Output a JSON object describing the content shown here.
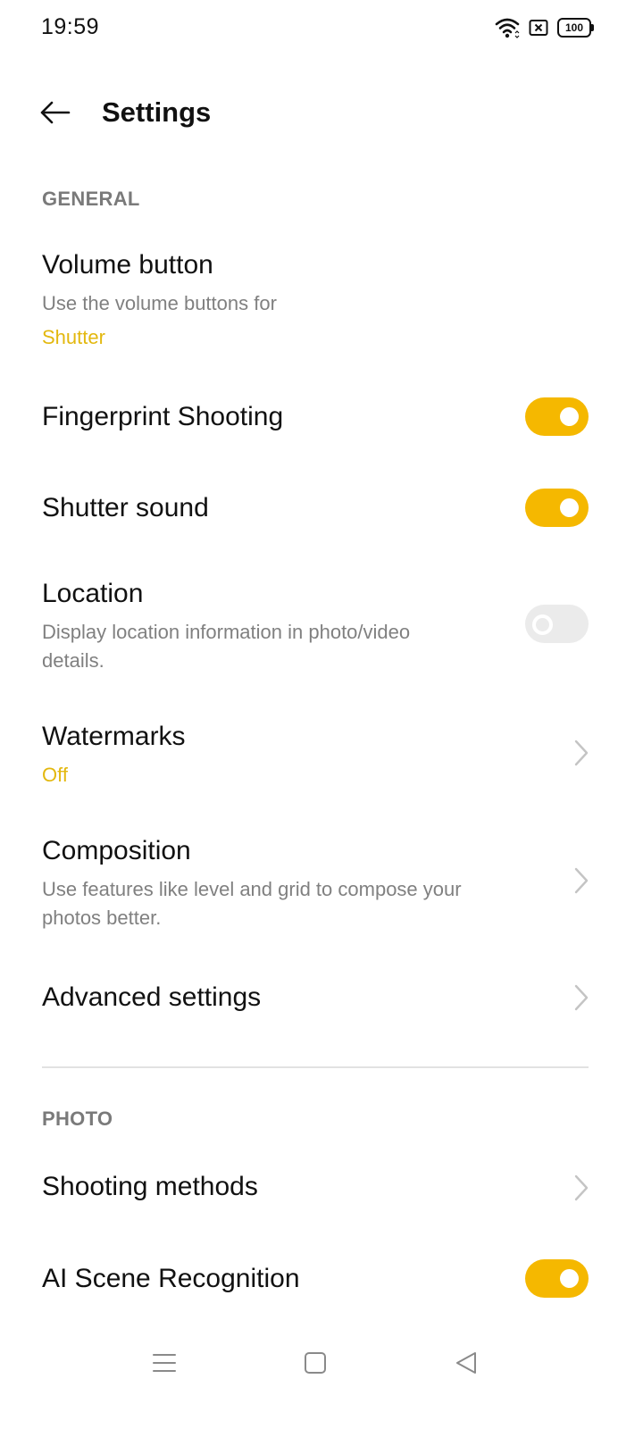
{
  "status_bar": {
    "time": "19:59",
    "icons": [
      "wifi-icon",
      "sim-no-service-icon",
      "battery-icon"
    ],
    "battery_level": "100"
  },
  "header": {
    "back_icon": "arrow-left-icon",
    "title": "Settings"
  },
  "sections": {
    "general": {
      "header": "GENERAL",
      "volume_button": {
        "title": "Volume button",
        "subtitle": "Use the volume buttons for",
        "value": "Shutter"
      },
      "fingerprint_shooting": {
        "title": "Fingerprint Shooting",
        "toggle_state": "on"
      },
      "shutter_sound": {
        "title": "Shutter sound",
        "toggle_state": "on"
      },
      "location": {
        "title": "Location",
        "subtitle": "Display location information in photo/video details.",
        "toggle_state": "off"
      },
      "watermarks": {
        "title": "Watermarks",
        "value": "Off"
      },
      "composition": {
        "title": "Composition",
        "subtitle": "Use features like level and grid to compose your photos better."
      },
      "advanced_settings": {
        "title": "Advanced settings"
      }
    },
    "photo": {
      "header": "PHOTO",
      "shooting_methods": {
        "title": "Shooting methods"
      },
      "ai_scene_recognition": {
        "title": "AI Scene Recognition",
        "toggle_state": "on"
      }
    }
  },
  "nav_bar": {
    "icons": [
      "menu-icon",
      "home-icon",
      "back-triangle-icon"
    ]
  },
  "colors": {
    "accent": "#f5b800",
    "value_text": "#e3b80f",
    "secondary_text": "#808080",
    "section_header": "#7a7a7a",
    "toggle_off": "#ebebeb"
  }
}
